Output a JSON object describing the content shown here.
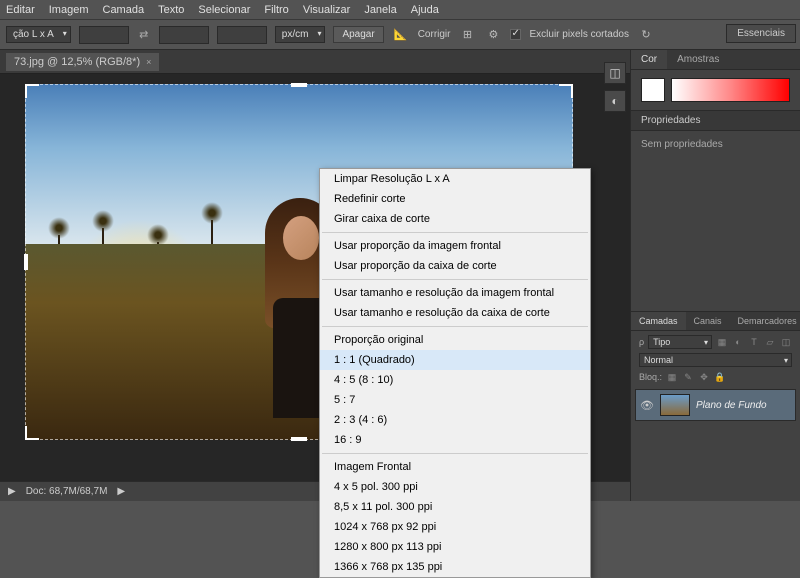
{
  "menu": {
    "items": [
      "Editar",
      "Imagem",
      "Camada",
      "Texto",
      "Selecionar",
      "Filtro",
      "Visualizar",
      "Janela",
      "Ajuda"
    ]
  },
  "optbar": {
    "ratio_preset": "ção L x A",
    "unit": "px/cm",
    "clear": "Apagar",
    "straighten": "Corrigir",
    "delete_cropped": "Excluir pixels cortados",
    "essentials": "Essenciais"
  },
  "doc": {
    "tab": "73.jpg @ 12,5% (RGB/8*)",
    "close": "×"
  },
  "context": {
    "g1": [
      "Limpar Resolução L x A",
      "Redefinir corte",
      "Girar caixa de corte"
    ],
    "g2": [
      "Usar proporção da imagem frontal",
      "Usar proporção da caixa de corte"
    ],
    "g3": [
      "Usar tamanho e resolução da imagem frontal",
      "Usar tamanho e resolução da caixa de corte"
    ],
    "g4_header": "Proporção original",
    "g4": [
      "1 : 1 (Quadrado)",
      "4 : 5 (8 : 10)",
      "5 : 7",
      "2 : 3 (4 : 6)",
      "16 : 9"
    ],
    "g5_header": "Imagem Frontal",
    "g5": [
      "4 x 5 pol. 300 ppi",
      "8,5 x 11 pol. 300 ppi",
      "1024 x 768 px 92 ppi",
      "1280 x 800 px 113 ppi",
      "1366 x 768 px 135 ppi"
    ]
  },
  "status": {
    "doc": "Doc: 68,7M/68,7M",
    "arrow": "▶"
  },
  "right": {
    "color_tab": "Cor",
    "swatches_tab": "Amostras",
    "props_header": "Propriedades",
    "no_props": "Sem propriedades",
    "layers_tab": "Camadas",
    "channels_tab": "Canais",
    "paths_tab": "Demarcadores",
    "filter": "Tipo",
    "blend": "Normal",
    "opacity_lbl": "",
    "lock": "Bloq.:",
    "layer_name": "Plano de Fundo"
  }
}
